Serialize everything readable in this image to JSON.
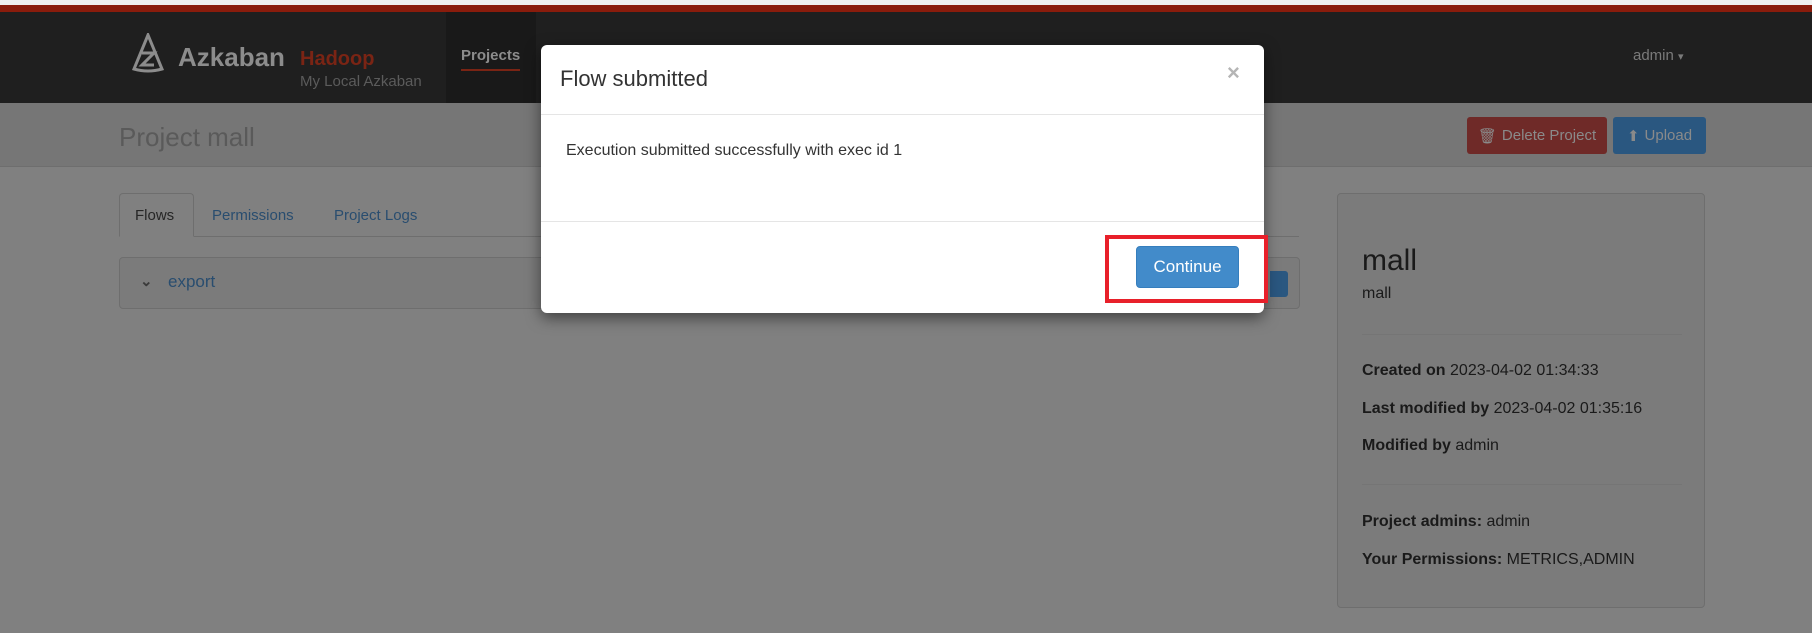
{
  "navbar": {
    "brand": "Azkaban",
    "brand_sub": "Hadoop",
    "environment": "My Local Azkaban",
    "nav_projects": "Projects",
    "user": "admin",
    "user_caret": "▾"
  },
  "header": {
    "title": "Project mall",
    "delete_label": "Delete Project",
    "upload_label": "Upload",
    "delete_icon": "🗑",
    "upload_icon": "⬆"
  },
  "tabs": [
    {
      "label": "Flows",
      "active": true
    },
    {
      "label": "Permissions"
    },
    {
      "label": "Project Logs"
    }
  ],
  "flows": [
    {
      "name": "export",
      "icon": "chevron-down"
    }
  ],
  "info": {
    "name": "mall",
    "description": "mall",
    "created_label": "Created on",
    "created_value": "2023-04-02 01:34:33",
    "last_modified_label": "Last modified by",
    "last_modified_value": "2023-04-02 01:35:16",
    "modified_by_label": "Modified by",
    "modified_by_value": "admin",
    "admins_label": "Project admins:",
    "admins_value": "admin",
    "permissions_label": "Your Permissions:",
    "permissions_value": "METRICS,ADMIN"
  },
  "modal": {
    "title": "Flow submitted",
    "close": "×",
    "body": "Execution submitted successfully with exec id 1",
    "continue_label": "Continue"
  },
  "colors": {
    "accent": "#428bca",
    "brand_red": "#8a1c0c",
    "highlight": "#e8202a"
  }
}
